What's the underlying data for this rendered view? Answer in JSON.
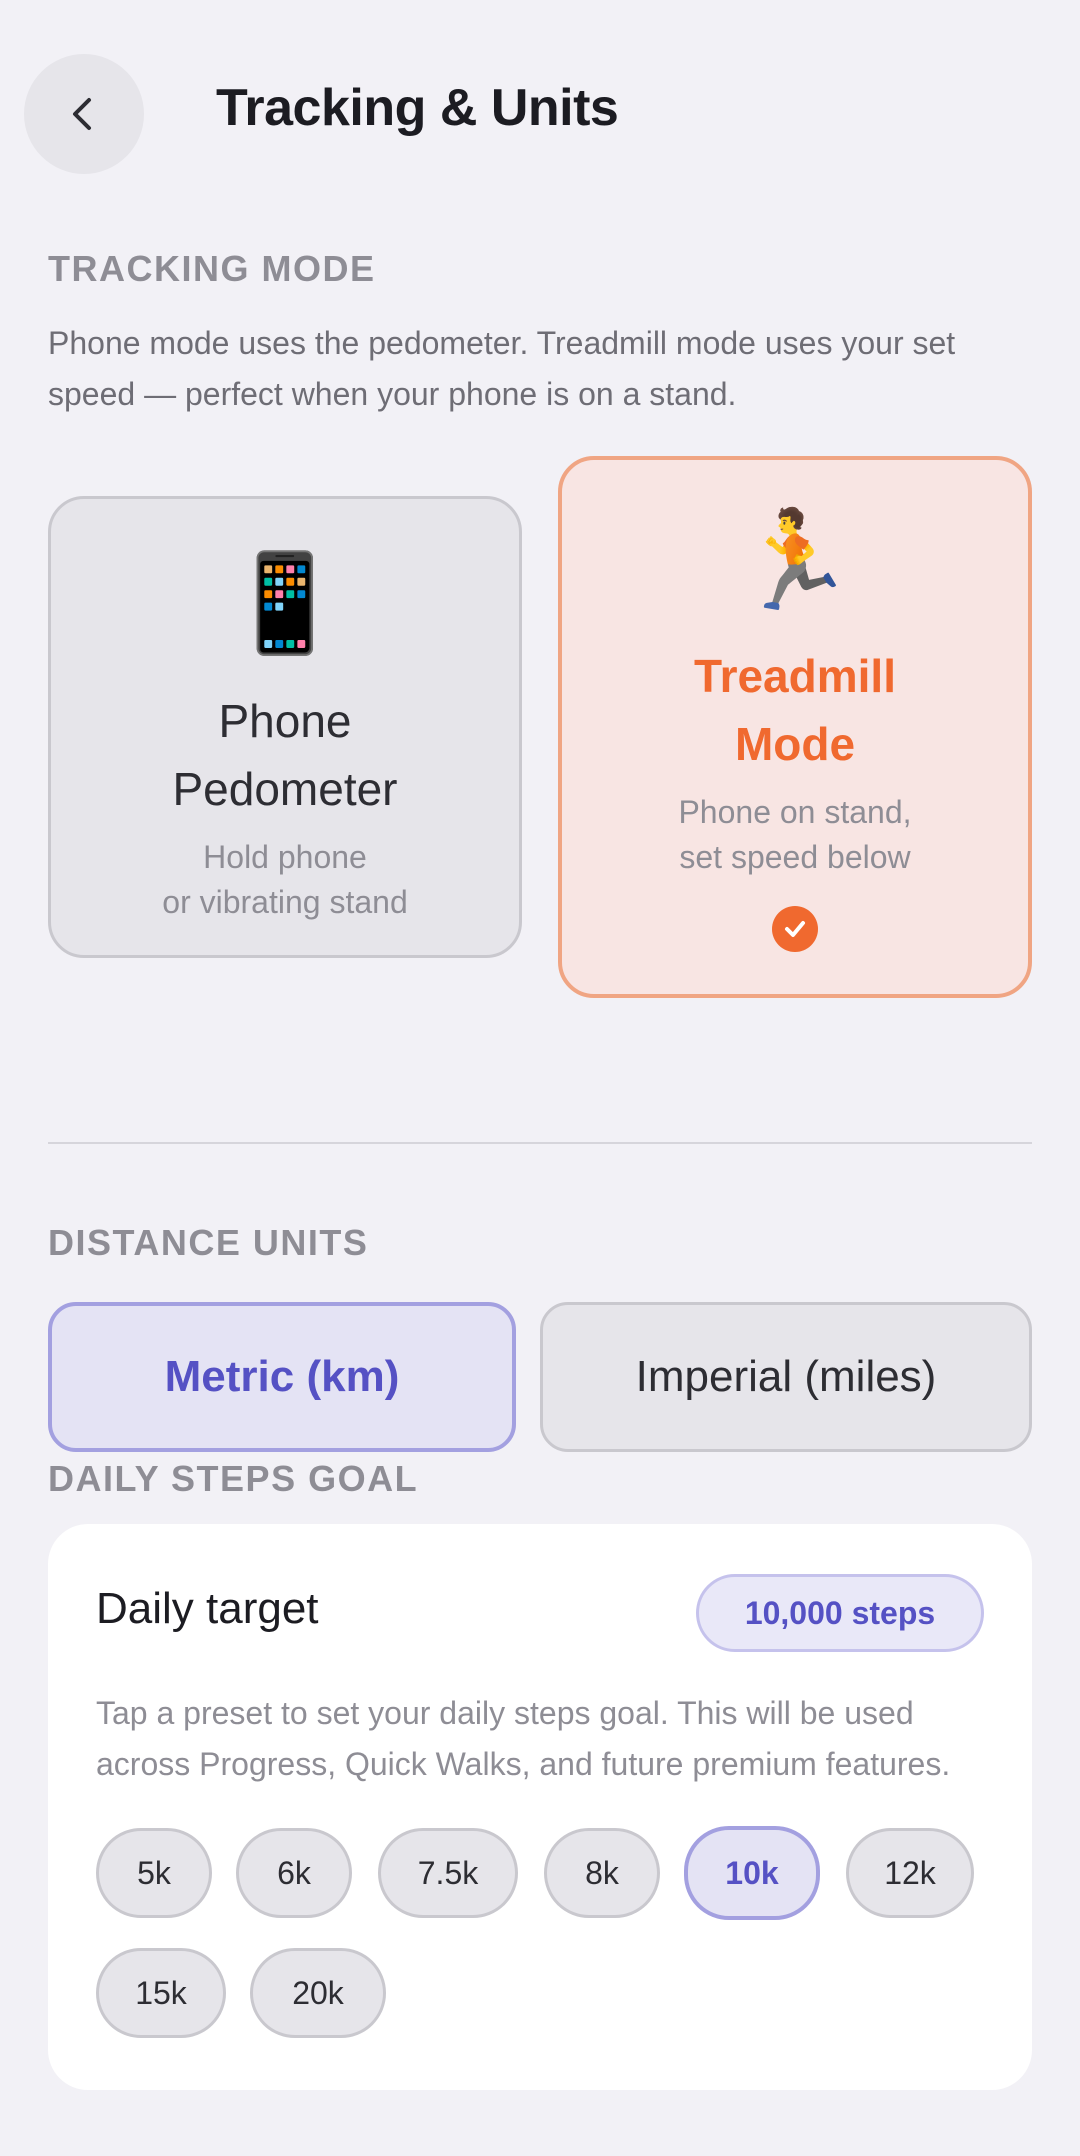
{
  "header": {
    "title": "Tracking & Units",
    "back_icon": "chevron-left-icon"
  },
  "tracking": {
    "section_label": "TRACKING MODE",
    "description": "Phone mode uses the pedometer. Treadmill mode uses your set speed — perfect when your phone is on a stand.",
    "modes": [
      {
        "id": "phone",
        "icon": "📱",
        "title_line1": "Phone",
        "title_line2": "Pedometer",
        "sub_line1": "Hold phone",
        "sub_line2": "or vibrating stand",
        "selected": false
      },
      {
        "id": "treadmill",
        "icon": "🏃",
        "title_line1": "Treadmill",
        "title_line2": "Mode",
        "sub_line1": "Phone on stand,",
        "sub_line2": "set speed below",
        "selected": true
      }
    ]
  },
  "units": {
    "section_label": "DISTANCE UNITS",
    "options": [
      {
        "id": "metric",
        "label": "Metric (km)",
        "selected": true
      },
      {
        "id": "imperial",
        "label": "Imperial (miles)",
        "selected": false
      }
    ]
  },
  "goal": {
    "section_label": "DAILY STEPS GOAL",
    "target_label": "Daily target",
    "target_value": "10,000 steps",
    "description": "Tap a preset to set your daily steps goal. This will be used across Progress, Quick Walks, and future premium features.",
    "presets": [
      "5k",
      "6k",
      "7.5k",
      "8k",
      "10k",
      "12k",
      "15k",
      "20k"
    ],
    "selected_preset": "10k"
  },
  "colors": {
    "accent_orange": "#f0692f",
    "accent_purple": "#5551c4",
    "background": "#f2f1f6"
  }
}
